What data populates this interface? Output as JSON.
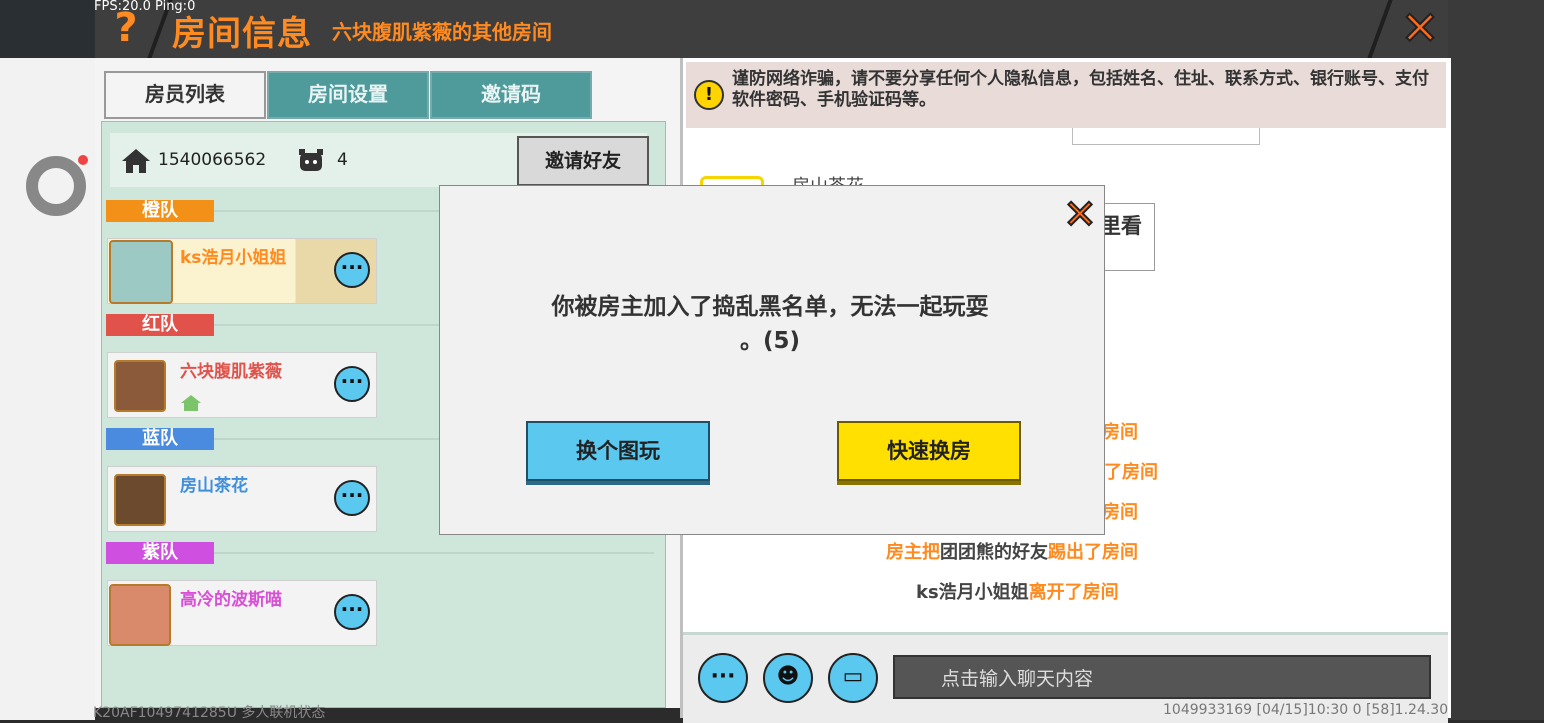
{
  "header": {
    "fps": "FPS:20.0  Ping:0",
    "help": "?",
    "title": "房间信息",
    "subtitle": "六块腹肌紫薇的其他房间",
    "close": "✕"
  },
  "tabs": [
    {
      "label": "房员列表"
    },
    {
      "label": "房间设置"
    },
    {
      "label": "邀请码"
    }
  ],
  "room": {
    "id": "1540066562",
    "player_count": "4",
    "invite_label": "邀请好友"
  },
  "teams": [
    {
      "label": "橙队",
      "color": "#f29018",
      "member": "ks浩月小姐姐",
      "name_color": "#ff8a1f"
    },
    {
      "label": "红队",
      "color": "#e0524a",
      "member": "六块腹肌紫薇",
      "name_color": "#e0524a"
    },
    {
      "label": "蓝队",
      "color": "#4a8be0",
      "member": "房山茶花",
      "name_color": "#3f8fdc"
    },
    {
      "label": "紫队",
      "color": "#cf4fe0",
      "member": "高冷的波斯喵",
      "name_color": "#d94fd6"
    }
  ],
  "more_glyph": "···",
  "warning": {
    "icon": "!",
    "text": "谨防网络诈骗，请不要分享任何个人隐私信息，包括姓名、住址、联系方式、银行账号、支付软件密码、手机验证码等。"
  },
  "chat": {
    "partial_name": "房山茶花",
    "partial_btn": "里看",
    "line1": "房间",
    "line2": "了房间",
    "line3": "房间",
    "line4_a": "房主把",
    "line4_b": "团团熊的好友",
    "line4_c": "踢出了房间",
    "line5_a": "ks浩月小姐姐",
    "line5_b": "离开了房间"
  },
  "dialog": {
    "close": "✕",
    "message_line1": "你被房主加入了捣乱黑名单，无法一起玩耍",
    "message_line2": "。(5)",
    "btn_change_map": "换个图玩",
    "btn_quick_room": "快速换房"
  },
  "footer": {
    "more": "···",
    "emoji": "☻",
    "card": "▭",
    "chat_placeholder": "点击输入聊天内容",
    "left_text": "K20AF1049741285U 多人联机状态",
    "right_text": "1049933169    [04/15]10:30 0    [58]1.24.30"
  }
}
